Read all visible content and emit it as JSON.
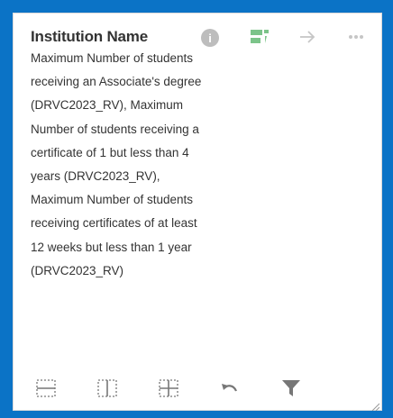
{
  "card": {
    "title": "Institution Name",
    "description": "Maximum Number of students receiving an Associate's degree (DRVC2023_RV), Maximum Number of students receiving a certificate of 1 but less than 4 years (DRVC2023_RV), Maximum Number of students receiving certificates of at least 12 weeks but less than 1 year (DRVC2023_RV)"
  },
  "header_icons": {
    "info": "i"
  },
  "colors": {
    "frame": "#0b73c6",
    "accent_green": "#7cc48a",
    "icon_gray": "#bdbdbd",
    "footer_gray": "#777777"
  }
}
